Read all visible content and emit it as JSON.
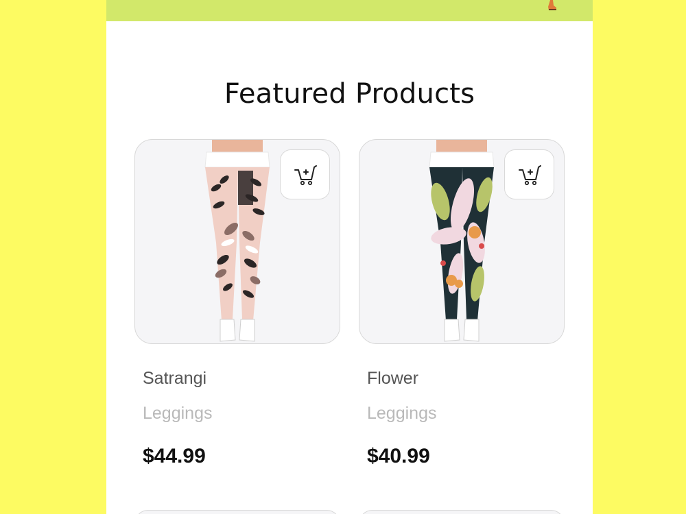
{
  "header": {
    "bar_color": "#d2e86a",
    "corner_icon": "sneaker-icon"
  },
  "section": {
    "title": "Featured Products"
  },
  "products": [
    {
      "name": "Satrangi",
      "category": "Leggings",
      "price": "$44.99",
      "image": "floral-leggings-pink-black",
      "cart_icon": "add-to-cart-icon"
    },
    {
      "name": "Flower",
      "category": "Leggings",
      "price": "$40.99",
      "image": "floral-leggings-dark-green",
      "cart_icon": "add-to-cart-icon"
    }
  ],
  "colors": {
    "page_background": "#fdfb62",
    "card_background": "#f5f5f7",
    "text_primary": "#111111",
    "text_secondary": "#555555",
    "text_muted": "#b9b9b9"
  }
}
